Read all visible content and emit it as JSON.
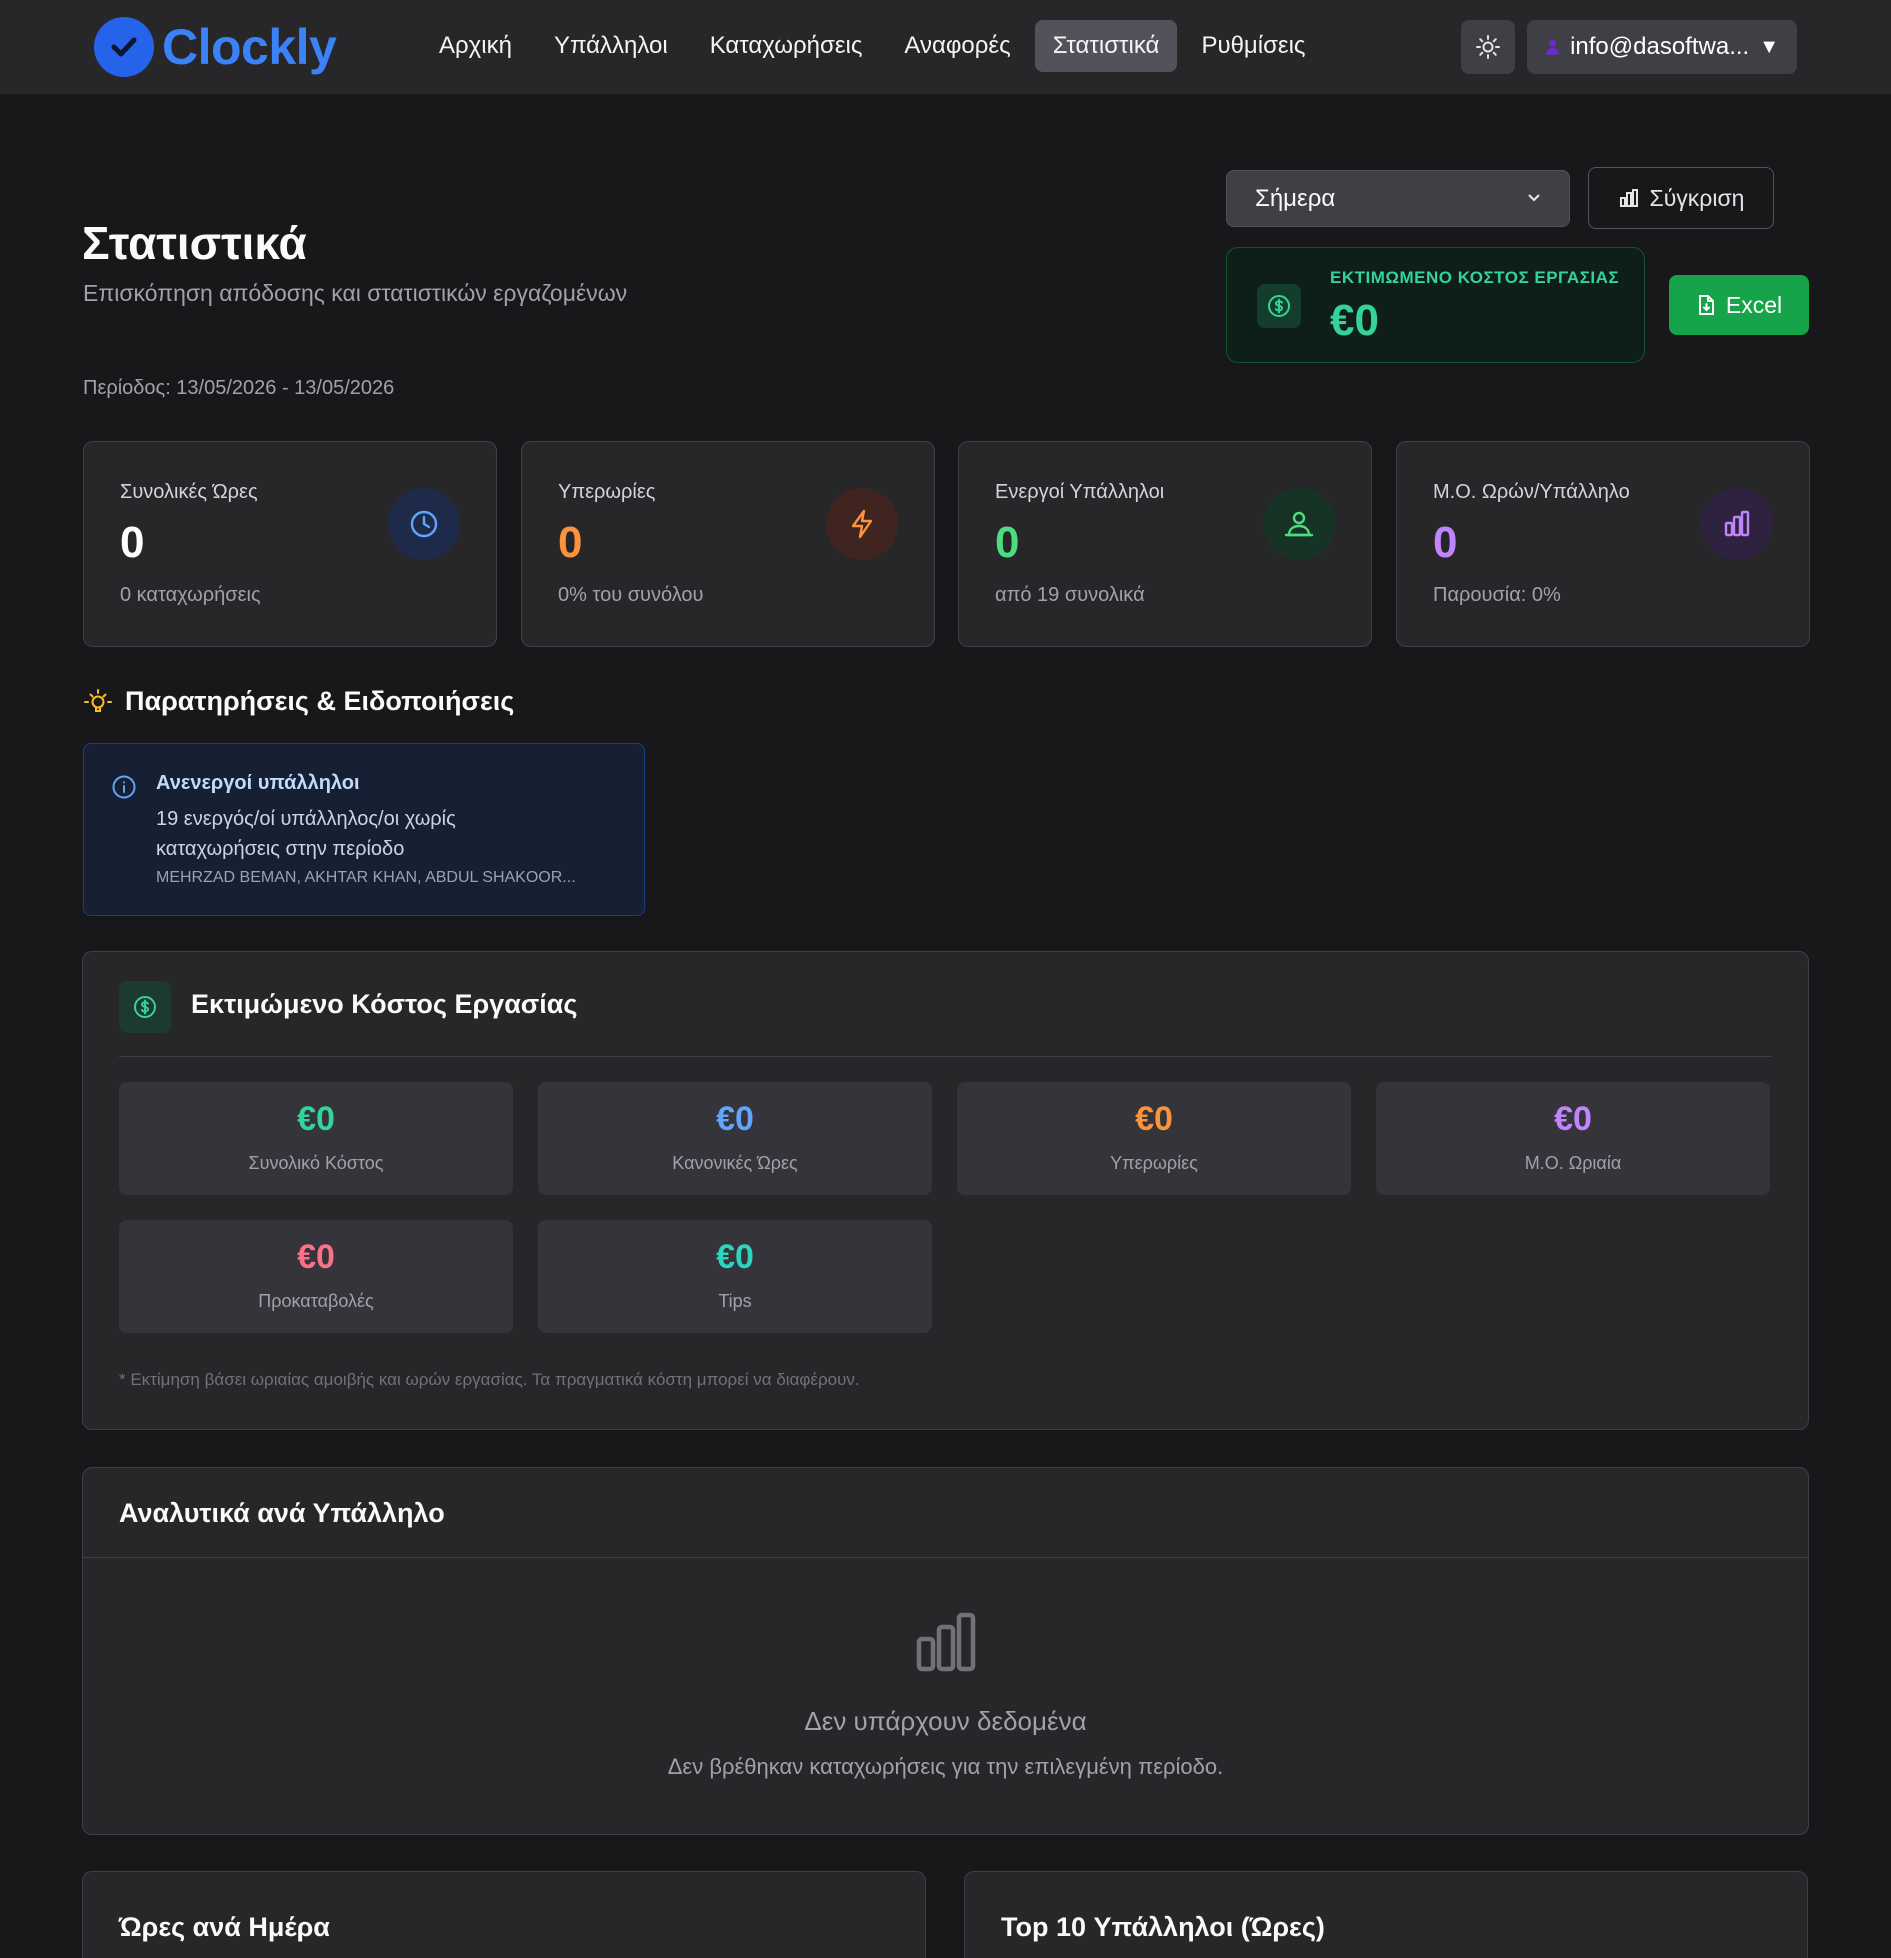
{
  "brand": {
    "name": "Clockly"
  },
  "nav": {
    "items": [
      {
        "label": "Αρχική"
      },
      {
        "label": "Υπάλληλοι"
      },
      {
        "label": "Καταχωρήσεις"
      },
      {
        "label": "Αναφορές"
      },
      {
        "label": "Στατιστικά"
      },
      {
        "label": "Ρυθμίσεις"
      }
    ],
    "active_label": "Στατιστικά"
  },
  "user": {
    "email": "info@dasoftwa..."
  },
  "header": {
    "title": "Στατιστικά",
    "subtitle": "Επισκόπηση απόδοσης και στατιστικών εργαζομένων",
    "period": "Περίοδος: 13/05/2026 - 13/05/2026"
  },
  "controls": {
    "period_select": "Σήμερα",
    "compare_label": "Σύγκριση",
    "excel_label": "Excel"
  },
  "cost_chip": {
    "label": "ΕΚΤΙΜΩΜΕΝΟ ΚΟΣΤΟΣ ΕΡΓΑΣΙΑΣ",
    "value": "€0"
  },
  "stats": [
    {
      "label": "Συνολικές Ώρες",
      "value": "0",
      "sub": "0 καταχωρήσεις",
      "color": "#ffffff",
      "icon": "clock-icon"
    },
    {
      "label": "Υπερωρίες",
      "value": "0",
      "sub": "0% του συνόλου",
      "color": "#fb923c",
      "icon": "bolt-icon"
    },
    {
      "label": "Ενεργοί Υπάλληλοι",
      "value": "0",
      "sub": "από 19 συνολικά",
      "color": "#4ade80",
      "icon": "users-icon"
    },
    {
      "label": "Μ.Ο. Ωρών/Υπάλληλο",
      "value": "0",
      "sub": "Παρουσία: 0%",
      "color": "#c084fc",
      "icon": "bar-chart-icon"
    }
  ],
  "observations": {
    "title": "Παρατηρήσεις & Ειδοποιήσεις",
    "alert_title": "Ανενεργοί υπάλληλοι",
    "alert_text": "19 ενεργός/οί υπάλληλος/οι χωρίς καταχωρήσεις στην περίοδο",
    "alert_names": "MEHRZAD BEMAN, AKHTAR KHAN, ABDUL SHAKOOR..."
  },
  "cost_panel": {
    "title": "Εκτιμώμενο Κόστος Εργασίας",
    "items": [
      {
        "value": "€0",
        "label": "Συνολικό Κόστος",
        "color": "#34d399"
      },
      {
        "value": "€0",
        "label": "Κανονικές Ώρες",
        "color": "#60a5fa"
      },
      {
        "value": "€0",
        "label": "Υπερωρίες",
        "color": "#fb923c"
      },
      {
        "value": "€0",
        "label": "Μ.Ο. Ωριαία",
        "color": "#c084fc"
      },
      {
        "value": "€0",
        "label": "Προκαταβολές",
        "color": "#fb7185"
      },
      {
        "value": "€0",
        "label": "Tips",
        "color": "#2dd4bf"
      }
    ],
    "note": "* Εκτίμηση βάσει ωριαίας αμοιβής και ωρών εργασίας. Τα πραγματικά κόστη μπορεί να διαφέρουν."
  },
  "breakdown": {
    "title": "Αναλυτικά ανά Υπάλληλο",
    "empty_title": "Δεν υπάρχουν δεδομένα",
    "empty_text": "Δεν βρέθηκαν καταχωρήσεις για την επιλεγμένη περίοδο."
  },
  "bottom": {
    "hours_per_day": "Ώρες ανά Ημέρα",
    "top10": "Top 10 Υπάλληλοι (Ώρες)"
  }
}
